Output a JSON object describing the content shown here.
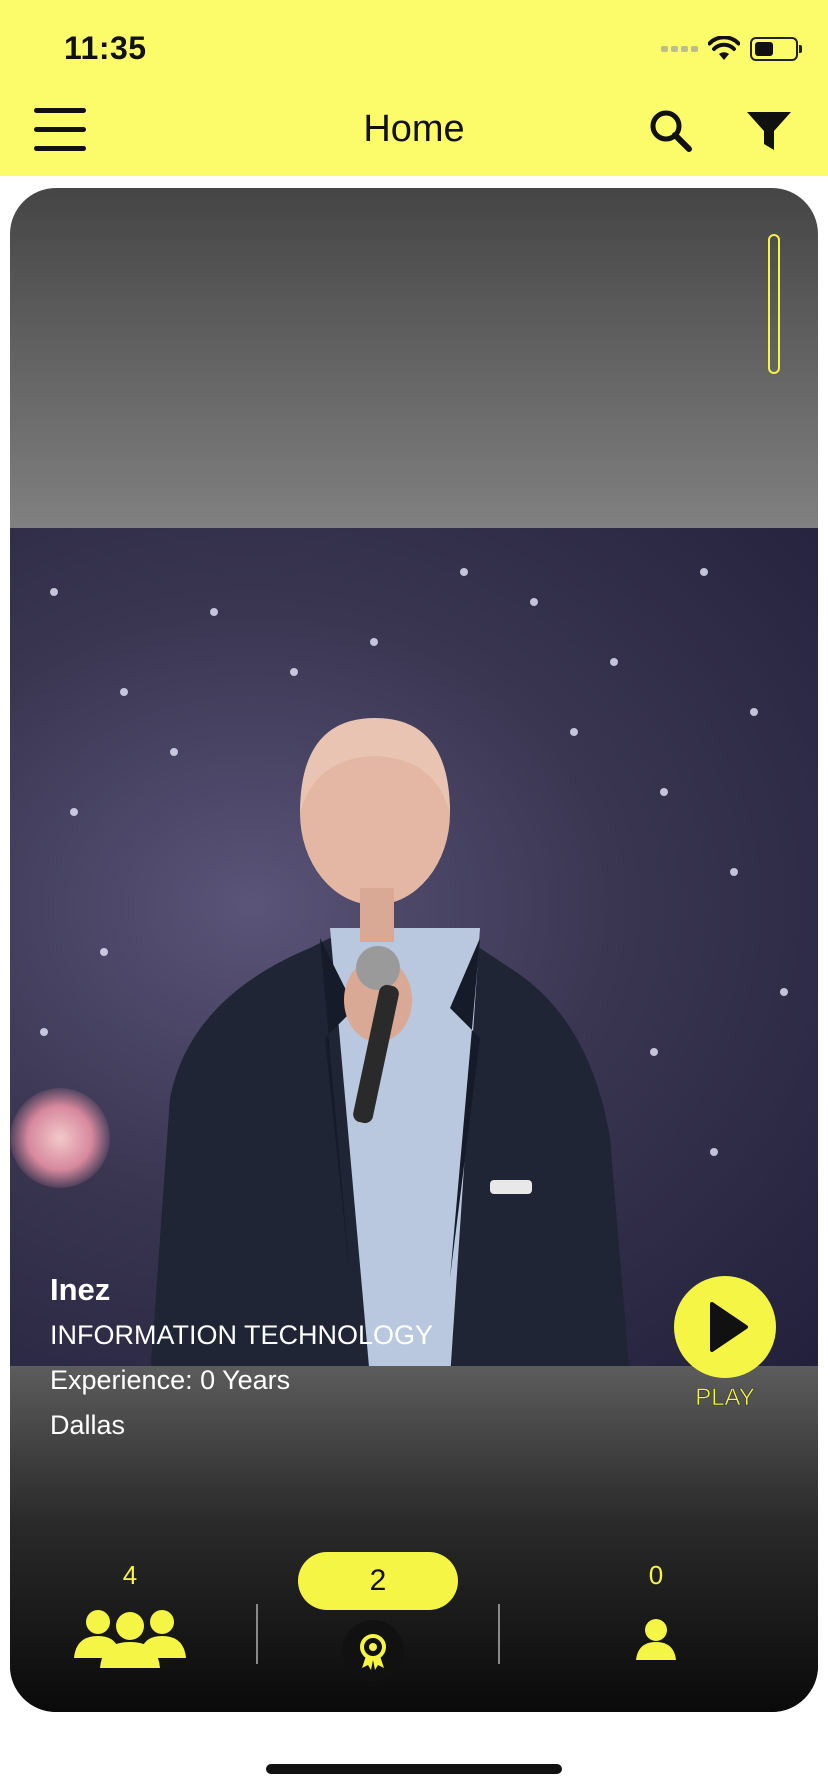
{
  "status_bar": {
    "time": "11:35"
  },
  "header": {
    "title": "Home"
  },
  "profile": {
    "name": "Inez",
    "industry": "INFORMATION TECHNOLOGY",
    "experience": "Experience: 0 Years",
    "location": "Dallas"
  },
  "play": {
    "label": "PLAY"
  },
  "bottom_nav": {
    "groups_count": "4",
    "awards_count": "2",
    "profile_count": "0"
  },
  "colors": {
    "accent": "#f5f545",
    "header_background": "#fcfc6b",
    "card_dark": "#111111"
  },
  "icons": [
    "menu-icon",
    "search-icon",
    "filter-icon",
    "play-icon",
    "group-icon",
    "award-icon",
    "person-icon",
    "wifi-icon",
    "battery-icon",
    "signal-icon"
  ]
}
